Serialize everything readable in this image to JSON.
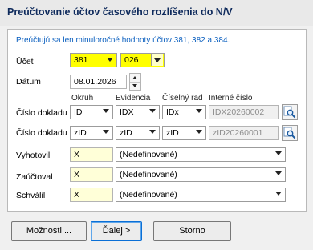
{
  "window": {
    "title": "Preúčtovanie účtov časového rozlíšenia do N/V"
  },
  "info_text": "Preúčtujú sa len minuloročné hodnoty účtov 381, 382 a 384.",
  "ucet": {
    "label": "Účet",
    "value": "381",
    "sub_value": "026"
  },
  "datum": {
    "label": "Dátum",
    "value": "08.01.2026"
  },
  "columns": {
    "okruh": "Okruh",
    "evidencia": "Evidencia",
    "ciselny_rad": "Číselný rad",
    "interne_cislo": "Interné číslo"
  },
  "doklad_rows": [
    {
      "label": "Číslo dokladu",
      "okruh": "ID",
      "evidencia": "IDX",
      "ciselny_rad": "IDx",
      "interne_cislo": "IDX20260002"
    },
    {
      "label": "Číslo dokladu",
      "okruh": "zID",
      "evidencia": "zID",
      "ciselny_rad": "zID",
      "interne_cislo": "zID20260001"
    }
  ],
  "people": [
    {
      "label": "Vyhotovil",
      "code": "X",
      "value": "(Nedefinované)"
    },
    {
      "label": "Zaúčtoval",
      "code": "X",
      "value": "(Nedefinované)"
    },
    {
      "label": "Schválil",
      "code": "X",
      "value": "(Nedefinované)"
    }
  ],
  "buttons": {
    "options": "Možnosti ...",
    "next": "Ďalej >",
    "cancel": "Storno"
  },
  "colors": {
    "accent_yellow": "#ffff00",
    "input_cream": "#ffffd8",
    "info_blue": "#0a5fbf",
    "title_navy": "#0e2a5c"
  }
}
